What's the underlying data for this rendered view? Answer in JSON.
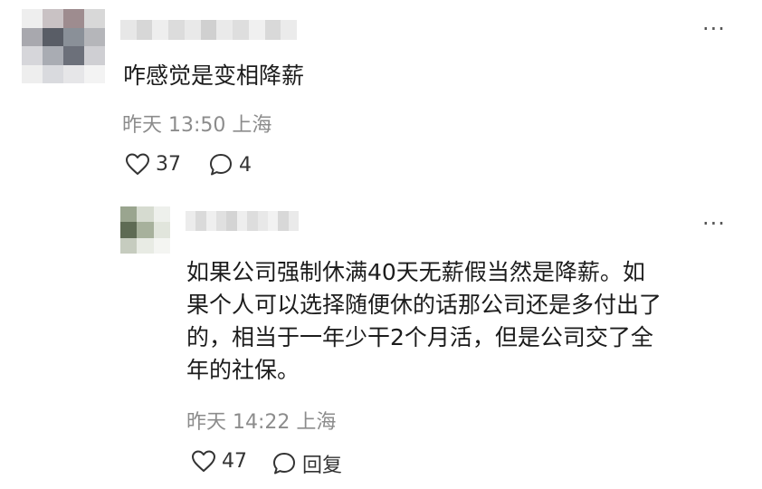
{
  "comment": {
    "text": "咋感觉是变相降薪",
    "meta": "昨天 13:50 上海",
    "likes": "37",
    "replies": "4",
    "more": "···",
    "icons": {
      "like": "heart-icon",
      "comment": "comment-bubble-icon",
      "more": "more-icon"
    }
  },
  "reply": {
    "text_lines": [
      "如果公司强制休满40天无薪假当然是降薪。如",
      "果个人可以选择随便休的话那公司还是多付出了",
      "的，相当于一年少干2个月活，但是公司交了全",
      "年的社保。"
    ],
    "meta": "昨天 14:22 上海",
    "likes": "47",
    "reply_label": "回复",
    "more": "···"
  },
  "colors": {
    "avatar1": [
      "#eeeeee",
      "#c9c2c4",
      "#9e8c8f",
      "#d8d8d8",
      "#a8a8ae",
      "#595d66",
      "#8a9098",
      "#b5b6ba",
      "#d6d6da",
      "#a9acb3",
      "#6c707a",
      "#cfcfd3",
      "#eeeeee",
      "#d9dade",
      "#e6e6e8",
      "#f3f3f3"
    ],
    "avatar2": [
      "#9aa58f",
      "#d6dbd0",
      "#eef0ec",
      "#5e6b54",
      "#a7b19c",
      "#e1e5dc",
      "#c6ccbf",
      "#e8ebe4",
      "#f4f5f2"
    ],
    "name1": [
      "#e7e7e7",
      "#d7d7d7",
      "#eeeeee",
      "#dcdcdc",
      "#e9e9e9",
      "#d0d0d0",
      "#eaeaea",
      "#dedede",
      "#f0f0f0",
      "#d9d9d9",
      "#ebebeb"
    ],
    "name2": [
      "#ececec",
      "#dadada",
      "#efefef",
      "#e0e0e0",
      "#d4d4d4",
      "#eeeeee",
      "#dddddd",
      "#e8e8e8",
      "#f2f2f2",
      "#d8d8d8",
      "#eaeaea"
    ]
  }
}
